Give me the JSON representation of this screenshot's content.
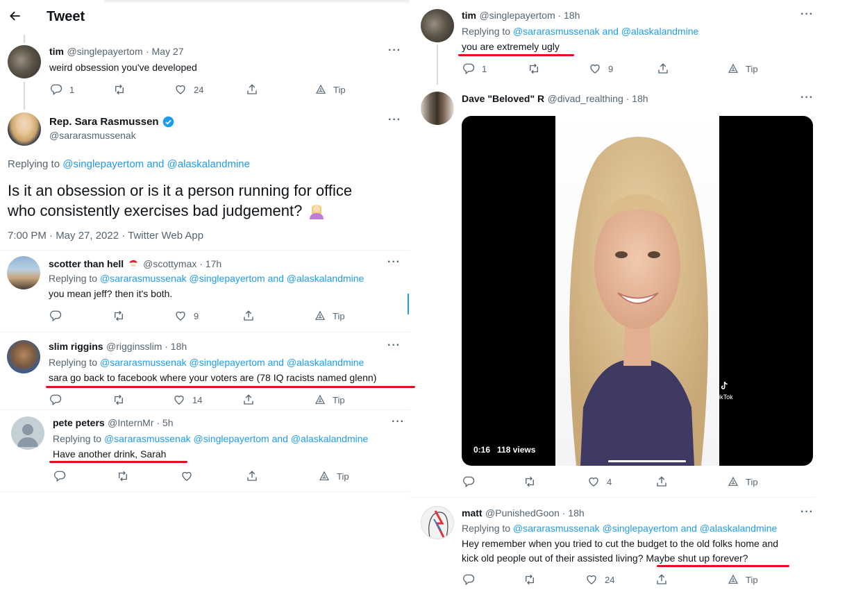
{
  "header": {
    "back_icon": "arrow-left-icon",
    "title": "Tweet"
  },
  "left": {
    "tweet1": {
      "name": "tim",
      "handle": "@singlepayertom",
      "date": "· May 27",
      "text": "weird obsession you've developed",
      "reply_count": "1",
      "like_count": "24",
      "tip": "Tip"
    },
    "main": {
      "name": "Rep. Sara Rasmussen",
      "handle": "@sararasmussenak",
      "replying_prefix": "Replying to ",
      "replying_users": "@singlepayertom and @alaskalandmine",
      "text_line1": "Is it an obsession or is it a person running for office",
      "text_line2": "who consistently exercises bad judgement?",
      "meta": "7:00 PM · May 27, 2022 · Twitter Web App"
    },
    "reply1": {
      "name": "scotter than hell",
      "handle": "@scottymax · 17h",
      "replying_prefix": "Replying to ",
      "replying_users": "@sararasmussenak @singlepayertom and @alaskalandmine",
      "text": "you mean jeff? then it's both.",
      "like_count": "9",
      "tip": "Tip"
    },
    "reply2": {
      "name": "slim riggins",
      "handle": "@rigginsslim · 18h",
      "replying_prefix": "Replying to ",
      "replying_users": "@sararasmussenak @singlepayertom and @alaskalandmine",
      "text": "sara go back to facebook where your voters are (78 IQ racists named glenn)",
      "like_count": "14",
      "tip": "Tip"
    },
    "reply3": {
      "name": "pete peters",
      "handle": "@InternMr · 5h",
      "replying_prefix": "Replying to ",
      "replying_users": "@sararasmussenak @singlepayertom and @alaskalandmine",
      "text": "Have another drink, Sarah",
      "tip": "Tip"
    }
  },
  "right": {
    "tweet1": {
      "name": "tim",
      "handle": "@singlepayertom · 18h",
      "replying_prefix": "Replying to ",
      "replying_users": "@sararasmussenak and @alaskalandmine",
      "text": "you are extremely ugly",
      "reply_count": "1",
      "like_count": "9",
      "tip": "Tip"
    },
    "tweet2": {
      "name": "Dave \"Beloved\" R",
      "handle": "@divad_realthing · 18h",
      "video_time": "0:16",
      "video_views": "118 views",
      "tiktok_label": "TikTok",
      "like_count": "4",
      "tip": "Tip"
    },
    "tweet3": {
      "name": "matt",
      "handle": "@PunishedGoon · 18h",
      "replying_prefix": "Replying to ",
      "replying_users": "@sararasmussenak @singlepayertom and @alaskalandmine",
      "text_line1": "Hey remember when you tried to cut the budget to the old folks home and",
      "text_line2_a": "kick old people out of their assisted living? ",
      "text_line2_b": "Maybe shut up forever?",
      "like_count": "24",
      "tip": "Tip"
    }
  },
  "colors": {
    "link": "#1d9bf0",
    "verified": "#1d9bf0",
    "underline": "#e0111f",
    "muted": "#536471"
  }
}
